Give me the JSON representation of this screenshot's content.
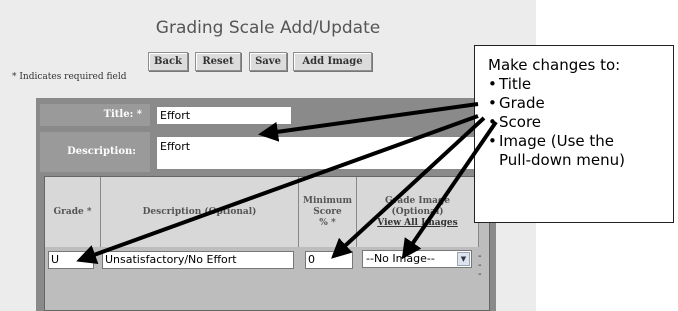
{
  "page": {
    "title": "Grading Scale Add/Update",
    "required_note": "* Indicates required field"
  },
  "toolbar": {
    "back": "Back",
    "reset": "Reset",
    "save": "Save",
    "add_image": "Add Image"
  },
  "form": {
    "title_label": "Title:",
    "title_required": "*",
    "title_value": "Effort",
    "description_label": "Description:",
    "description_value": "Effort"
  },
  "grid": {
    "headers": {
      "grade": "Grade *",
      "description": "Description (Optional)",
      "min_score_line1": "Minimum",
      "min_score_line2": "Score",
      "min_score_line3": "% *",
      "image_line1": "Grade Image",
      "image_line2": "(Optional)",
      "view_all_images": "View All Images"
    },
    "row": {
      "grade": "U",
      "description": "Unsatisfactory/No Effort",
      "min_score": "0",
      "image": "--No Image--"
    }
  },
  "callout": {
    "heading": "Make changes to:",
    "items": [
      "Title",
      "Grade",
      "Score",
      "Image (Use the",
      "Pull-down menu)"
    ]
  },
  "icons": {
    "select_arrow": "chevron-down-icon"
  }
}
